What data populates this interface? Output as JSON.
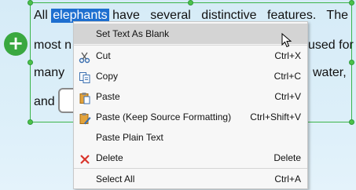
{
  "paragraph": {
    "line1_pre": "All",
    "line1_selected": "elephants",
    "line1_post": "have several distinctive features. The",
    "line2_start": "most n",
    "line2_end": "used for",
    "line3_start": "many",
    "line3_end": "water,",
    "line4_start": "and"
  },
  "context_menu": {
    "items": [
      {
        "label": "Set Text As Blank",
        "shortcut": "",
        "icon": "none"
      },
      {
        "label": "Cut",
        "shortcut": "Ctrl+X",
        "icon": "scissors-icon"
      },
      {
        "label": "Copy",
        "shortcut": "Ctrl+C",
        "icon": "copy-icon"
      },
      {
        "label": "Paste",
        "shortcut": "Ctrl+V",
        "icon": "paste-icon"
      },
      {
        "label": "Paste (Keep Source Formatting)",
        "shortcut": "Ctrl+Shift+V",
        "icon": "paste-format-icon"
      },
      {
        "label": "Paste Plain Text",
        "shortcut": "",
        "icon": "none"
      },
      {
        "label": "Delete",
        "shortcut": "Delete",
        "icon": "red-x-icon"
      },
      {
        "label": "Select All",
        "shortcut": "Ctrl+A",
        "icon": "none"
      }
    ]
  },
  "colors": {
    "selection": "#1e6fd0",
    "handle": "#4cc24a",
    "add_button": "#3aa840",
    "delete_icon": "#d9342b"
  }
}
